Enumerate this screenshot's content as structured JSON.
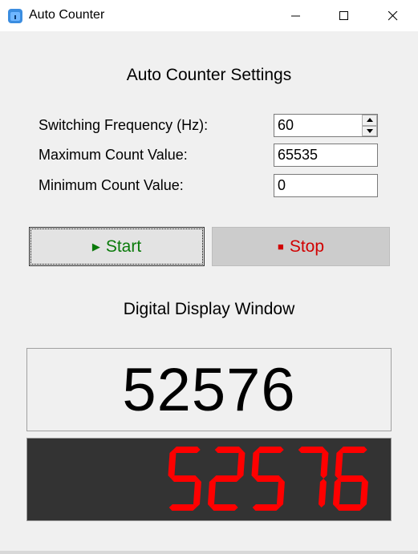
{
  "window": {
    "title": "Auto Counter",
    "icon": "app-counter-icon",
    "controls": [
      "minimize-icon",
      "maximize-icon",
      "close-icon"
    ]
  },
  "settings": {
    "heading": "Auto Counter Settings",
    "frequency_label": "Switching Frequency (Hz):",
    "frequency_value": "60",
    "max_label": "Maximum Count Value:",
    "max_value": "65535",
    "min_label": "Minimum Count Value:",
    "min_value": "0"
  },
  "controls": {
    "start_label": "Start",
    "start_glyph": "▶",
    "stop_label": "Stop",
    "stop_glyph": "■"
  },
  "display": {
    "heading": "Digital Display Window",
    "plain_value": "52576",
    "lcd_value": "52576"
  },
  "colors": {
    "start_text": "#0a7a0a",
    "stop_text": "#d10000",
    "lcd_background": "#333333",
    "lcd_segment": "#ff0000"
  }
}
